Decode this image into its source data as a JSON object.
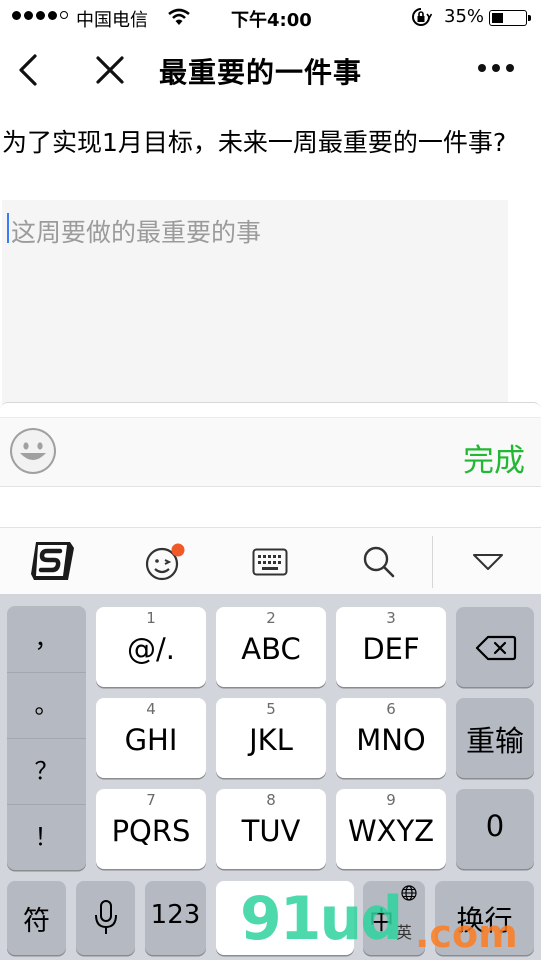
{
  "status_bar": {
    "carrier": "中国电信",
    "time": "下午4:00",
    "battery_percent": "35%",
    "battery_level": 0.35
  },
  "nav": {
    "title": "最重要的一件事"
  },
  "question": "为了实现1月目标，未来一周最重要的一件事?",
  "input": {
    "placeholder": "这周要做的最重要的事",
    "value": ""
  },
  "accessory": {
    "done_label": "完成"
  },
  "keyboard": {
    "punctuation": [
      "，",
      "。",
      "？",
      "！"
    ],
    "keys": [
      {
        "num": "1",
        "label": "@/."
      },
      {
        "num": "2",
        "label": "ABC"
      },
      {
        "num": "3",
        "label": "DEF"
      },
      {
        "num": "4",
        "label": "GHI"
      },
      {
        "num": "5",
        "label": "JKL"
      },
      {
        "num": "6",
        "label": "MNO"
      },
      {
        "num": "7",
        "label": "PQRS"
      },
      {
        "num": "8",
        "label": "TUV"
      },
      {
        "num": "9",
        "label": "WXYZ"
      }
    ],
    "reenter_label": "重输",
    "zero_label": "0",
    "symbol_label": "符",
    "number_label": "123",
    "lang_label": "中",
    "lang_sub": "英",
    "newline_label": "换行"
  },
  "watermark": {
    "text": "91ud",
    "suffix": ".com"
  },
  "colors": {
    "accent_green": "#22b833",
    "caret": "#3b7cf6",
    "badge": "#f05a28"
  }
}
